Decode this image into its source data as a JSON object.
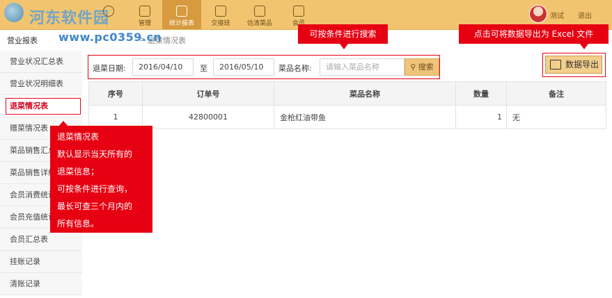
{
  "header": {
    "watermark_title": "河东软件园",
    "watermark_url": "www.pc0359.cn",
    "nav": [
      {
        "label": "",
        "icon": "clock-icon"
      },
      {
        "label": "管理",
        "icon": "menu-icon"
      },
      {
        "label": "统计报表",
        "icon": "chart-icon",
        "active": true
      },
      {
        "label": "交接班",
        "icon": "briefcase-icon"
      },
      {
        "label": "估清菜品",
        "icon": "calendar-icon"
      },
      {
        "label": "会员",
        "icon": "export-icon"
      }
    ],
    "user_name": "测试",
    "user_link": "退出"
  },
  "breadcrumb": {
    "first": "营业报表",
    "current": "退菜情况表"
  },
  "sidebar": {
    "items": [
      {
        "label": "营业状况汇总表"
      },
      {
        "label": "营业状况明细表"
      },
      {
        "label": "退菜情况表",
        "active": true
      },
      {
        "label": "赠菜情况表"
      },
      {
        "label": "菜品销售汇总"
      },
      {
        "label": "菜品销售详细"
      },
      {
        "label": "会员消费统计"
      },
      {
        "label": "会员充值统计"
      },
      {
        "label": "会员汇总表"
      },
      {
        "label": "挂账记录"
      },
      {
        "label": "清账记录"
      }
    ]
  },
  "filter": {
    "date_label": "退菜日期:",
    "start_date": "2016/04/10",
    "to_label": "至",
    "end_date": "2016/05/10",
    "dish_label": "菜品名称:",
    "dish_placeholder": "请输入菜品名称",
    "search_label": "搜索"
  },
  "export": {
    "label": "数据导出"
  },
  "table": {
    "headers": [
      "序号",
      "订单号",
      "菜品名称",
      "数量",
      "备注"
    ],
    "rows": [
      [
        "1",
        "42800001",
        "金枪红油带鱼",
        "1",
        "无"
      ]
    ]
  },
  "callouts": {
    "top": "可按条件进行搜索",
    "right": "点击可将数据导出为 Excel 文件",
    "left": [
      "退菜情况表",
      "默认显示当天所有的",
      "退菜信息；",
      "可按条件进行查询，",
      "最长可查三个月内的",
      "所有信息。"
    ]
  },
  "colors": {
    "accent": "#f2c46f",
    "highlight": "#e60012"
  }
}
